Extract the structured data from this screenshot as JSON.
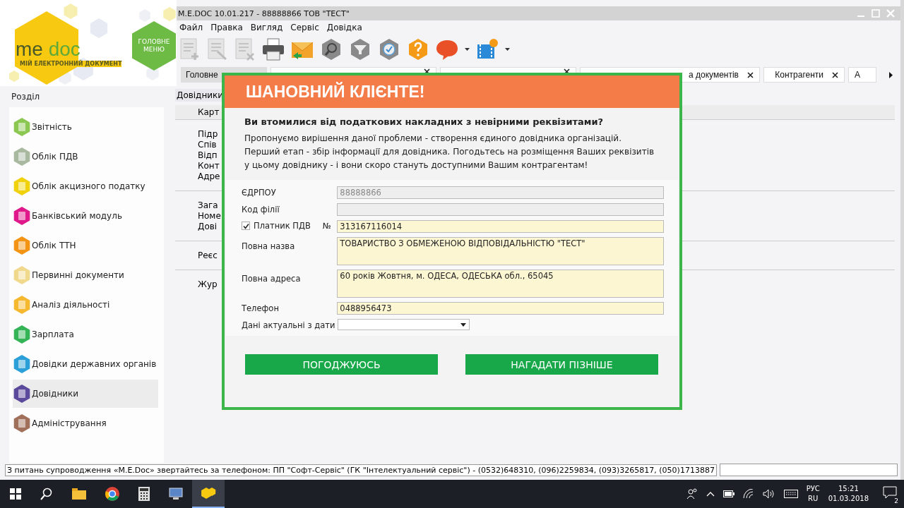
{
  "logo": {
    "name_a": "me",
    "name_b": "doc",
    "tagline": "МІЙ ЕЛЕКТРОННИЙ ДОКУМЕНТ",
    "main_menu": "ГОЛОВНЕ МЕНЮ"
  },
  "window": {
    "title": "M.E.DOC 10.01.217  - 88888866 ТОВ \"ТЕСТ\""
  },
  "menu": [
    "Файл",
    "Правка",
    "Вигляд",
    "Сервіс",
    "Довідка"
  ],
  "tabs": [
    {
      "label": "Головне",
      "closable": false,
      "selected": true
    },
    {
      "closable": true,
      "selected": false
    },
    {
      "closable": true,
      "selected": false
    },
    {
      "label": "а документів",
      "closable": true,
      "selected": false
    },
    {
      "label": "Контрагенти",
      "closable": true,
      "selected": false
    },
    {
      "label": "А",
      "closable": false,
      "selected": false
    }
  ],
  "sidebar": {
    "title": "Розділ",
    "items": [
      {
        "label": "Звітність",
        "color": "#8cc751",
        "selected": false
      },
      {
        "label": "Облік ПДВ",
        "color": "#a9b9a0",
        "selected": false
      },
      {
        "label": "Облік акцизного податку",
        "color": "#efd20b",
        "selected": false
      },
      {
        "label": "Банківський модуль",
        "color": "#e0198a",
        "selected": false
      },
      {
        "label": "Облік ТТН",
        "color": "#f39414",
        "selected": false
      },
      {
        "label": "Первинні документи",
        "color": "#f0d98c",
        "selected": false
      },
      {
        "label": "Аналіз діяльності",
        "color": "#f5b82e",
        "selected": false
      },
      {
        "label": "Зарплата",
        "color": "#34b456",
        "selected": false
      },
      {
        "label": "Довідки державних органів",
        "color": "#2a9fd8",
        "selected": false
      },
      {
        "label": "Довідники",
        "color": "#5b4a9c",
        "selected": true
      },
      {
        "label": "Адміністрування",
        "color": "#a0705a",
        "selected": false
      }
    ]
  },
  "content": {
    "title": "Довідники",
    "column": "Карт",
    "groups": [
      [
        "Підр",
        "Спів",
        "Відп",
        "Конт",
        "Адре"
      ],
      [
        "Зага",
        "Номе",
        "Дові"
      ],
      [
        "Реєс"
      ],
      [
        "Жур"
      ]
    ]
  },
  "dialog": {
    "title": "ШАНОВНИЙ КЛІЄНТЕ!",
    "question": "Ви втомилися від податкових накладних з невірними реквізитами?",
    "lines": [
      "Пропонуємо вирішення даної проблеми - створення єдиного довідника організацій.",
      "Перший етап - збір інформації для довідника. Погодьтесь на розміщення Ваших реквізитів",
      "у цьому довіднику - і вони скоро стануть доступними Вашим контрагентам!"
    ],
    "fields": [
      {
        "kind": "input",
        "label": "ЄДРПОУ",
        "value": "88888866",
        "disabled": true
      },
      {
        "kind": "input",
        "label": "Код філії",
        "disabled": true
      },
      {
        "kind": "check",
        "label": "Платник ПДВ",
        "checked": true,
        "number_label": "№",
        "value": "313167116014",
        "disabled": false
      },
      {
        "kind": "area",
        "label": "Повна назва",
        "value": "ТОВАРИСТВО З ОБМЕЖЕНОЮ ВІДПОВІДАЛЬНІСТЮ \"ТЕСТ\"",
        "disabled": false
      },
      {
        "kind": "area",
        "label": "Повна адреса",
        "value": "60 років Жовтня, м. ОДЕСА, ОДЕСЬКА обл., 65045",
        "disabled": false
      },
      {
        "kind": "input",
        "label": "Телефон",
        "value": "0488956473",
        "disabled": false
      },
      {
        "kind": "select",
        "label": "Дані актуальні з дати",
        "disabled": false
      }
    ],
    "buttons": [
      "ПОГОДЖУЮСЬ",
      "НАГАДАТИ ПІЗНІШЕ"
    ]
  },
  "status_bar": {
    "text": "З питань супроводження «M.E.Doc» звертайтесь за телефоном: ПП \"Софт-Сервіс\" (ГК \"Інтелектуальний сервіс\") - (0532)648310, (096)2259834, (093)3265817, (050)1713887"
  },
  "taskbar": {
    "lang": "РУС",
    "layout": "RU",
    "time": "15:21",
    "date": "01.03.2018",
    "notifications": "2"
  }
}
